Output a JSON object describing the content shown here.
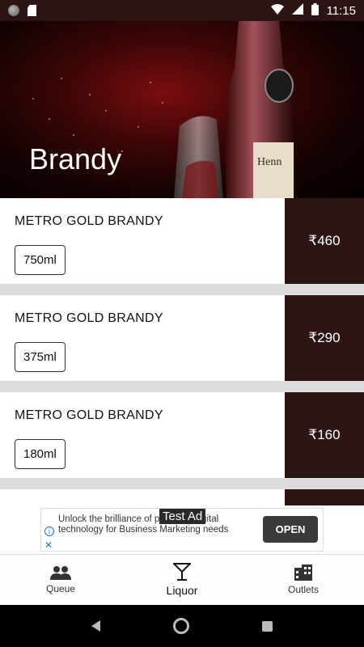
{
  "status_bar": {
    "time": "11:15"
  },
  "header": {
    "title": "Brandy"
  },
  "products": [
    {
      "name": "METRO GOLD BRANDY",
      "size": "750ml",
      "price": "₹460"
    },
    {
      "name": "METRO GOLD BRANDY",
      "size": "375ml",
      "price": "₹290"
    },
    {
      "name": "METRO GOLD BRANDY",
      "size": "180ml",
      "price": "₹160"
    }
  ],
  "ad": {
    "text": "Unlock the brilliance of proximity digital technology for Business Marketing needs",
    "badge": "Test Ad",
    "cta": "OPEN"
  },
  "bottom_nav": {
    "queue": "Queue",
    "liquor": "Liquor",
    "outlets": "Outlets"
  }
}
